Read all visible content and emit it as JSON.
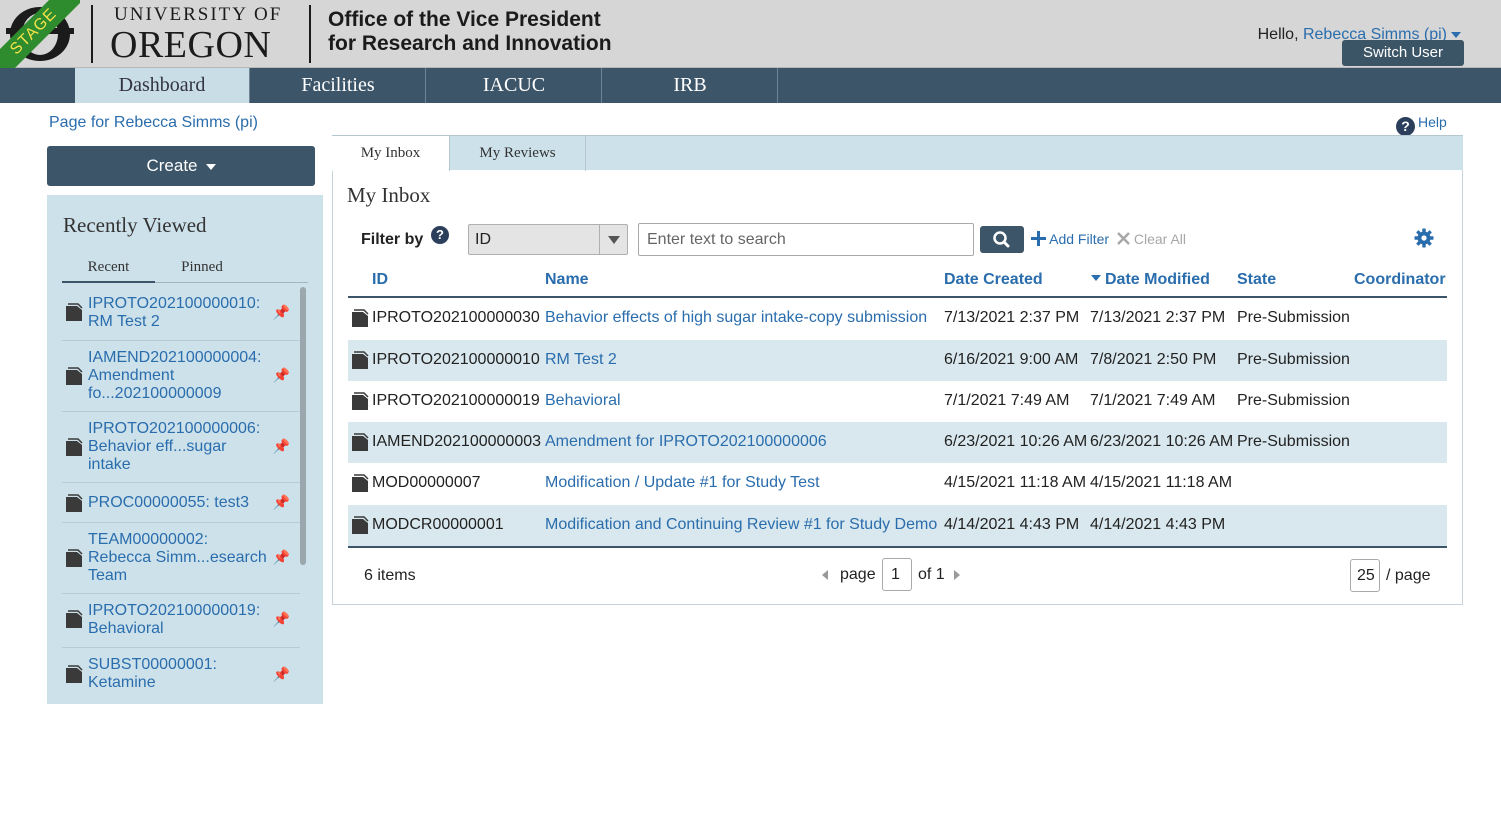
{
  "header": {
    "stage_label": "STAGE",
    "university_small": "UNIVERSITY OF",
    "university_big": "OREGON",
    "office_line1": "Office of the Vice President",
    "office_line2": "for Research and Innovation",
    "hello_prefix": "Hello,",
    "user_name": "Rebecca Simms (pi)",
    "switch_user_label": "Switch User"
  },
  "nav": {
    "tabs": [
      {
        "label": "Dashboard",
        "active": true
      },
      {
        "label": "Facilities",
        "active": false
      },
      {
        "label": "IACUC",
        "active": false
      },
      {
        "label": "IRB",
        "active": false
      }
    ]
  },
  "left": {
    "page_for": "Page for Rebecca Simms (pi)",
    "create_label": "Create",
    "recently_viewed_title": "Recently Viewed",
    "recent_tabs": [
      {
        "label": "Recent",
        "active": true
      },
      {
        "label": "Pinned",
        "active": false
      }
    ],
    "recent_items": [
      {
        "line1": "IPROTO202100000010:",
        "line2": "RM Test 2",
        "line3": ""
      },
      {
        "line1": "IAMEND202100000004:",
        "line2": "Amendment",
        "line3": "fo...202100000009"
      },
      {
        "line1": "IPROTO202100000006:",
        "line2": "Behavior eff...sugar",
        "line3": "intake"
      },
      {
        "line1": "PROC00000055: test3",
        "line2": "",
        "line3": ""
      },
      {
        "line1": "TEAM00000002:",
        "line2": "Rebecca Simm...esearch",
        "line3": "Team"
      },
      {
        "line1": "IPROTO202100000019:",
        "line2": "Behavioral",
        "line3": ""
      },
      {
        "line1": "SUBST00000001:",
        "line2": "Ketamine",
        "line3": ""
      }
    ]
  },
  "main": {
    "help_label": "Help",
    "tabs": [
      {
        "label": "My Inbox",
        "active": true
      },
      {
        "label": "My Reviews",
        "active": false
      }
    ],
    "title": "My Inbox",
    "filter_by_label": "Filter by",
    "filter_select_value": "ID",
    "search_placeholder": "Enter text to search",
    "add_filter_label": "Add Filter",
    "clear_all_label": "Clear All",
    "columns": [
      "ID",
      "Name",
      "Date Created",
      "Date Modified",
      "State",
      "Coordinator"
    ],
    "sorted_column": "Date Modified",
    "rows": [
      {
        "id": "IPROTO202100000030",
        "name": "Behavior effects of high sugar intake-copy submission",
        "created": "7/13/2021 2:37 PM",
        "modified": "7/13/2021 2:37 PM",
        "state": "Pre-Submission",
        "coordinator": ""
      },
      {
        "id": "IPROTO202100000010",
        "name": "RM Test 2",
        "created": "6/16/2021 9:00 AM",
        "modified": "7/8/2021 2:50 PM",
        "state": "Pre-Submission",
        "coordinator": ""
      },
      {
        "id": "IPROTO202100000019",
        "name": "Behavioral",
        "created": "7/1/2021 7:49 AM",
        "modified": "7/1/2021 7:49 AM",
        "state": "Pre-Submission",
        "coordinator": ""
      },
      {
        "id": "IAMEND202100000003",
        "name": "Amendment for IPROTO202100000006",
        "created": "6/23/2021 10:26 AM",
        "modified": "6/23/2021 10:26 AM",
        "state": "Pre-Submission",
        "coordinator": ""
      },
      {
        "id": "MOD00000007",
        "name": "Modification / Update #1 for Study Test",
        "created": "4/15/2021 11:18 AM",
        "modified": "4/15/2021 11:18 AM",
        "state": "",
        "coordinator": ""
      },
      {
        "id": "MODCR00000001",
        "name": "Modification and Continuing Review #1 for Study Demo",
        "created": "4/14/2021 4:43 PM",
        "modified": "4/14/2021 4:43 PM",
        "state": "",
        "coordinator": ""
      }
    ],
    "items_count": "6 items",
    "page_label": "page",
    "page_value": "1",
    "of_label": "of 1",
    "per_page_value": "25",
    "per_page_label": "/ page"
  },
  "colors": {
    "nav_bg": "#3d5568",
    "link": "#2a6dad",
    "panel_bg": "#cde1ea",
    "row_alt": "#d9e8ee"
  }
}
